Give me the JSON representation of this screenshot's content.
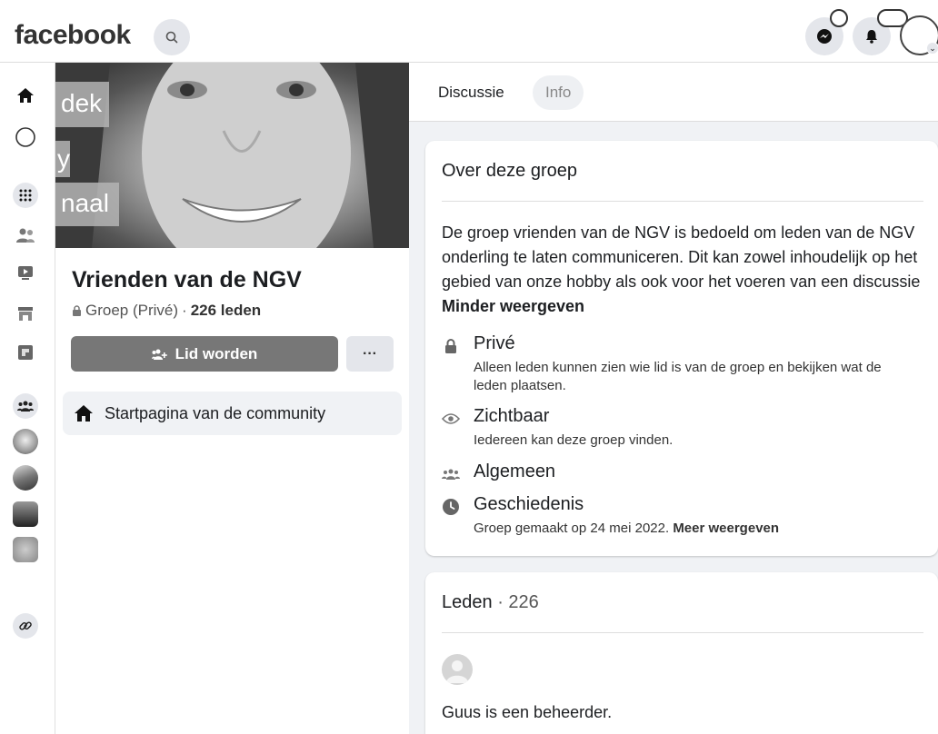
{
  "header": {
    "logo_text": "facebook",
    "icons": [
      "search-icon",
      "messenger-icon",
      "notifications-icon",
      "account-avatar"
    ]
  },
  "rail": {
    "items": [
      "home-icon",
      "circle-icon",
      "menu-grid-icon",
      "friends-icon",
      "watch-icon",
      "marketplace-icon",
      "gaming-icon",
      "groups-icon",
      "group-photo-1",
      "group-photo-2",
      "group-photo-3",
      "group-photo-4",
      "link-icon"
    ]
  },
  "cover": {
    "words": [
      "dek",
      "y",
      "naal"
    ]
  },
  "group": {
    "name": "Vrienden van de NGV",
    "privacy": "Groep (Privé)",
    "separator": "·",
    "members": "226 leden",
    "join_label": "Lid worden",
    "more_label": "···",
    "community_label": "Startpagina van de community"
  },
  "tabs": {
    "discussion": "Discussie",
    "info": "Info"
  },
  "about": {
    "title": "Over deze groep",
    "description": "De groep vrienden van de NGV is bedoeld om leden van de NGV onderling te laten communiceren. Dit kan zowel inhoudelijk op het gebied van onze hobby als ook voor het voeren van een discussie",
    "less_label": "Minder weergeven",
    "rows": {
      "private_title": "Privé",
      "private_sub": "Alleen leden kunnen zien wie lid is van de groep en bekijken wat de leden plaatsen.",
      "visible_title": "Zichtbaar",
      "visible_sub": "Iedereen kan deze groep vinden.",
      "general_title": "Algemeen",
      "history_title": "Geschiedenis",
      "history_sub": "Groep gemaakt op 24 mei 2022.",
      "history_more": "Meer weergeven"
    }
  },
  "members_card": {
    "title": "Leden",
    "count": "· 226",
    "admin_text": "Guus is een beheerder."
  }
}
